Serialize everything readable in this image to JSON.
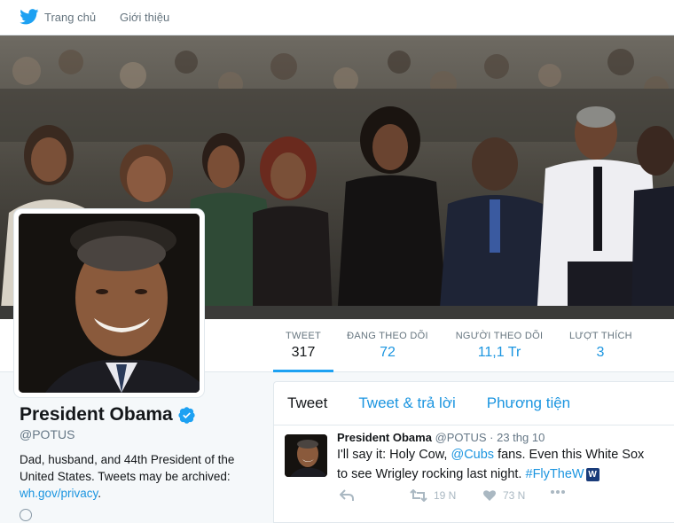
{
  "topnav": {
    "home_label": "Trang chủ",
    "about_label": "Giới thiệu"
  },
  "stats": [
    {
      "label": "TWEET",
      "value": "317"
    },
    {
      "label": "ĐANG THEO DÕI",
      "value": "72"
    },
    {
      "label": "NGƯỜI THEO DÕI",
      "value": "11,1 Tr"
    },
    {
      "label": "LƯỢT THÍCH",
      "value": "3"
    }
  ],
  "profile": {
    "name": "President Obama",
    "handle": "@POTUS",
    "bio": "Dad, husband, and 44th President of the United States. Tweets may be archived:",
    "bio_link": "wh.gov/privacy",
    "bio_link_suffix": "."
  },
  "timeline": {
    "tabs": [
      "Tweet",
      "Tweet & trả lời",
      "Phương tiện"
    ]
  },
  "tweet": {
    "name": "President Obama",
    "handle": "@POTUS",
    "separator": " · ",
    "time": "23 thg 10",
    "text_1": "I'll say it: Holy Cow, ",
    "mention": "@Cubs",
    "text_2": " fans. Even this White Sox",
    "text_3": "to see Wrigley rocking last night. ",
    "hashtag": "#FlyTheW",
    "emoji_letter": "W",
    "retweets": "19 N",
    "likes": "73 N"
  },
  "colors": {
    "accent": "#1da1f2",
    "link": "#1b95e0",
    "verified": "#1da1f2"
  }
}
